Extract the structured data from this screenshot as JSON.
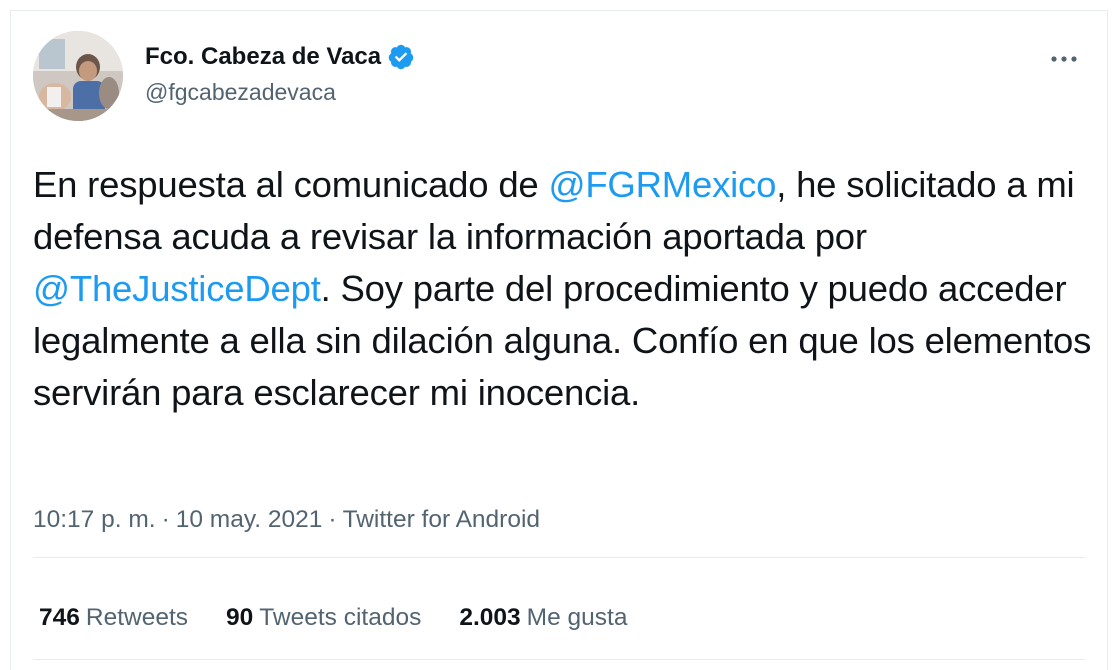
{
  "author": {
    "display_name": "Fco. Cabeza de Vaca",
    "handle": "@fgcabezadevaca",
    "verified_icon": "verified-badge-icon",
    "avatar": "profile-photo"
  },
  "menu_icon": "more-horizontal-icon",
  "tweet": {
    "text_parts": {
      "p1": "En respuesta al comunicado de ",
      "mention1": "@FGRMexico",
      "p2": ", he solicitado a mi defensa acuda a revisar la información aportada por ",
      "mention2": "@TheJusticeDept",
      "p3": ". Soy parte del procedimiento y puedo acceder legalmente a ella sin dilación alguna. Confío en que los elementos servirán para esclarecer mi inocencia."
    }
  },
  "meta": {
    "time": "10:17 p. m.",
    "separator": "·",
    "date": "10 may. 2021",
    "source": "Twitter for Android"
  },
  "stats": {
    "retweets_count": "746",
    "retweets_label": "Retweets",
    "quotes_count": "90",
    "quotes_label": "Tweets citados",
    "likes_count": "2.003",
    "likes_label": "Me gusta"
  },
  "colors": {
    "link": "#1d9bf0",
    "secondary_text": "#536471",
    "divider": "#e6ecf0"
  }
}
